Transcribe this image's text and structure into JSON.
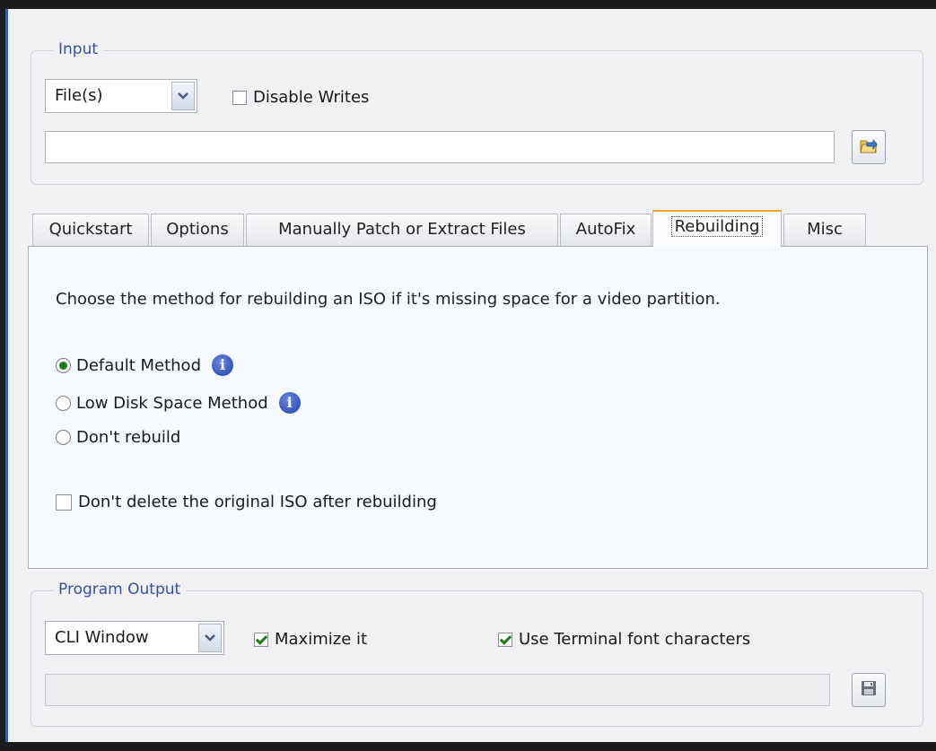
{
  "input": {
    "legend": "Input",
    "source_select": "File(s)",
    "disable_writes_label": "Disable Writes",
    "disable_writes_checked": false,
    "path_value": ""
  },
  "tabs": [
    {
      "label": "Quickstart",
      "active": false
    },
    {
      "label": "Options",
      "active": false
    },
    {
      "label": "Manually Patch or Extract Files",
      "active": false
    },
    {
      "label": "AutoFix",
      "active": false
    },
    {
      "label": "Rebuilding",
      "active": true
    },
    {
      "label": "Misc",
      "active": false
    }
  ],
  "rebuilding": {
    "description": "Choose the method for rebuilding an ISO if it's missing space for a video partition.",
    "options": [
      {
        "label": "Default Method",
        "selected": true
      },
      {
        "label": "Low Disk Space Method",
        "selected": false
      },
      {
        "label": "Don't rebuild",
        "selected": false
      }
    ],
    "keep_original_label": "Don't delete the original ISO after rebuilding",
    "keep_original_checked": false
  },
  "output": {
    "legend": "Program Output",
    "mode_select": "CLI Window",
    "maximize_label": "Maximize it",
    "maximize_checked": true,
    "terminal_font_label": "Use Terminal font characters",
    "terminal_font_checked": true,
    "path_value": ""
  },
  "icons": {
    "browse": "folder-browse-icon",
    "save": "save-floppy-icon",
    "info": "info-icon",
    "dropdown": "chevron-down-icon"
  }
}
